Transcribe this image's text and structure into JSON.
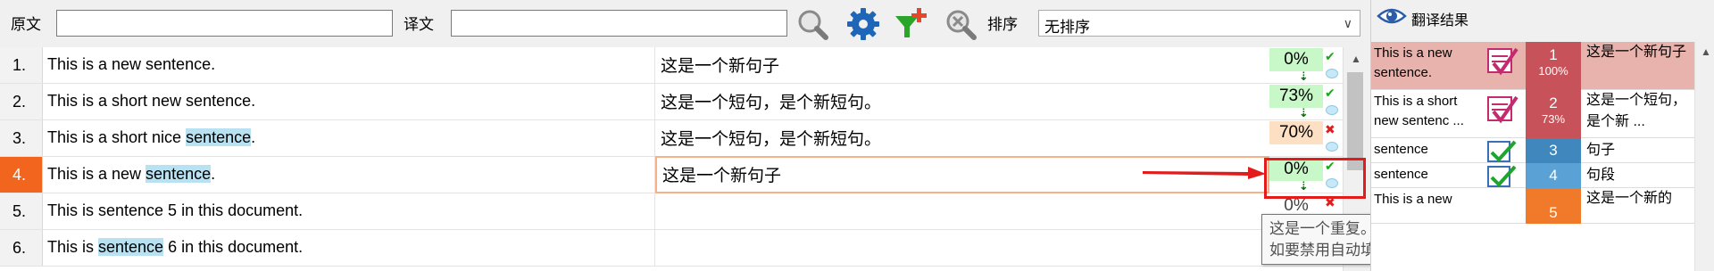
{
  "toolbar": {
    "source_label": "原文",
    "target_label": "译文",
    "sort_label": "排序",
    "sort_value": "无排序"
  },
  "rows": [
    {
      "num": "1.",
      "src_pre": "This is a new sentence.",
      "src_hl": "",
      "src_post": "",
      "tgt": "这是一个新句子",
      "pct": "0%",
      "status": "ok"
    },
    {
      "num": "2.",
      "src_pre": "This is a short new sentence.",
      "src_hl": "",
      "src_post": "",
      "tgt": "这是一个短句，是个新短句。",
      "pct": "73%",
      "status": "ok"
    },
    {
      "num": "3.",
      "src_pre": "This is a short nice ",
      "src_hl": "sentence",
      "src_post": ".",
      "tgt": "这是一个短句，是个新短句。",
      "pct": "70%",
      "status": "bad"
    },
    {
      "num": "4.",
      "src_pre": "This is a new ",
      "src_hl": "sentence",
      "src_post": ".",
      "tgt": "这是一个新句子",
      "pct": "0%",
      "status": "ok"
    },
    {
      "num": "5.",
      "src_pre": "This is sentence 5 in this document.",
      "src_hl": "",
      "src_post": "",
      "tgt": "",
      "pct": "0%",
      "status": "bad"
    },
    {
      "num": "6.",
      "src_pre": "This is ",
      "src_hl": "sentence",
      "src_post": " 6 in this document.",
      "tgt": "",
      "pct": "",
      "status": ""
    }
  ],
  "marks": {
    "ok": "✔",
    "bad": "✖"
  },
  "tooltip": {
    "line1": "这是一个重复。本行已启用自动填充功能。",
    "line2": "如要禁用自动填充功能，请双击该图标或按下 Ctrl+Shift+H。"
  },
  "panel": {
    "title": "翻译结果",
    "results": [
      {
        "src": "This is a new sentence.",
        "score": "1",
        "sub": "100%",
        "tgt": "这是一个新句子",
        "color": "#c8525a"
      },
      {
        "src": "This is a short new sentenc ...",
        "score": "2",
        "sub": "73%",
        "tgt": "这是一个短句，是个新 ...",
        "color": "#c8525a"
      },
      {
        "src": "sentence",
        "score": "3",
        "sub": "",
        "tgt": "句子",
        "color": "#3f87bd"
      },
      {
        "src": "sentence",
        "score": "4",
        "sub": "",
        "tgt": "句段",
        "color": "#5aa2d6"
      },
      {
        "src": "This is a new",
        "score": "5",
        "sub": "",
        "tgt": "这是一个新的",
        "color": "#f07a2a"
      }
    ]
  },
  "colors": {
    "active_row": "#f2651e",
    "pct_green": "#c8f7c8",
    "pct_orange": "#fde0c4",
    "highlight": "#b8e2f2",
    "callout_red": "#e31b1b"
  }
}
